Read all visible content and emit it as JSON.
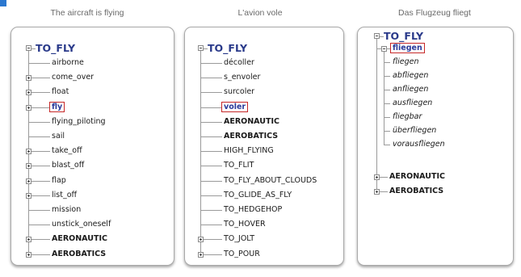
{
  "panels": [
    {
      "caption": "The aircraft is flying",
      "root": "TO_FLY",
      "items": [
        {
          "label": "airborne",
          "expander": "none"
        },
        {
          "label": "come_over",
          "expander": "plus"
        },
        {
          "label": "float",
          "expander": "plus"
        },
        {
          "label": "fly",
          "expander": "plus",
          "highlighted": true
        },
        {
          "label": "flying_piloting",
          "expander": "none"
        },
        {
          "label": "sail",
          "expander": "none"
        },
        {
          "label": "take_off",
          "expander": "plus"
        },
        {
          "label": "blast_off",
          "expander": "plus"
        },
        {
          "label": "flap",
          "expander": "plus"
        },
        {
          "label": "list_off",
          "expander": "plus"
        },
        {
          "label": "mission",
          "expander": "none"
        },
        {
          "label": "unstick_oneself",
          "expander": "none"
        },
        {
          "label": "AERONAUTIC",
          "expander": "plus",
          "bold": true
        },
        {
          "label": "AEROBATICS",
          "expander": "plus",
          "bold": true
        }
      ]
    },
    {
      "caption": "L'avion vole",
      "root": "TO_FLY",
      "items": [
        {
          "label": "décoller",
          "expander": "none"
        },
        {
          "label": "s_envoler",
          "expander": "none"
        },
        {
          "label": "surcoler",
          "expander": "none"
        },
        {
          "label": "voler",
          "expander": "none",
          "highlighted": true
        },
        {
          "label": "AERONAUTIC",
          "expander": "none",
          "bold": true
        },
        {
          "label": "AEROBATICS",
          "expander": "none",
          "bold": true
        },
        {
          "label": "HIGH_FLYING",
          "expander": "none"
        },
        {
          "label": "TO_FLIT",
          "expander": "none"
        },
        {
          "label": "TO_FLY_ABOUT_CLOUDS",
          "expander": "none"
        },
        {
          "label": "TO_GLIDE_AS_FLY",
          "expander": "none"
        },
        {
          "label": "TO_HEDGEHOP",
          "expander": "none"
        },
        {
          "label": "TO_HOVER",
          "expander": "none"
        },
        {
          "label": "TO_JOLT",
          "expander": "plus"
        },
        {
          "label": "TO_POUR",
          "expander": "plus"
        }
      ]
    },
    {
      "caption": "Das Flugzeug fliegt",
      "root": "TO_FLY",
      "group": {
        "label": "fliegen",
        "children": [
          "fliegen",
          "abfliegen",
          "anfliegen",
          "ausfliegen",
          "fliegbar",
          "überfliegen",
          "vorausfliegen"
        ]
      },
      "items": [
        {
          "label": "AERONAUTIC",
          "expander": "plus",
          "bold": true
        },
        {
          "label": "AEROBATICS",
          "expander": "plus",
          "bold": true
        }
      ]
    }
  ],
  "colors": {
    "root_text": "#2a3a8a",
    "highlight_border": "#c62828",
    "highlight_text": "#2a3a9a",
    "corner_mark": "#2b78d0"
  }
}
